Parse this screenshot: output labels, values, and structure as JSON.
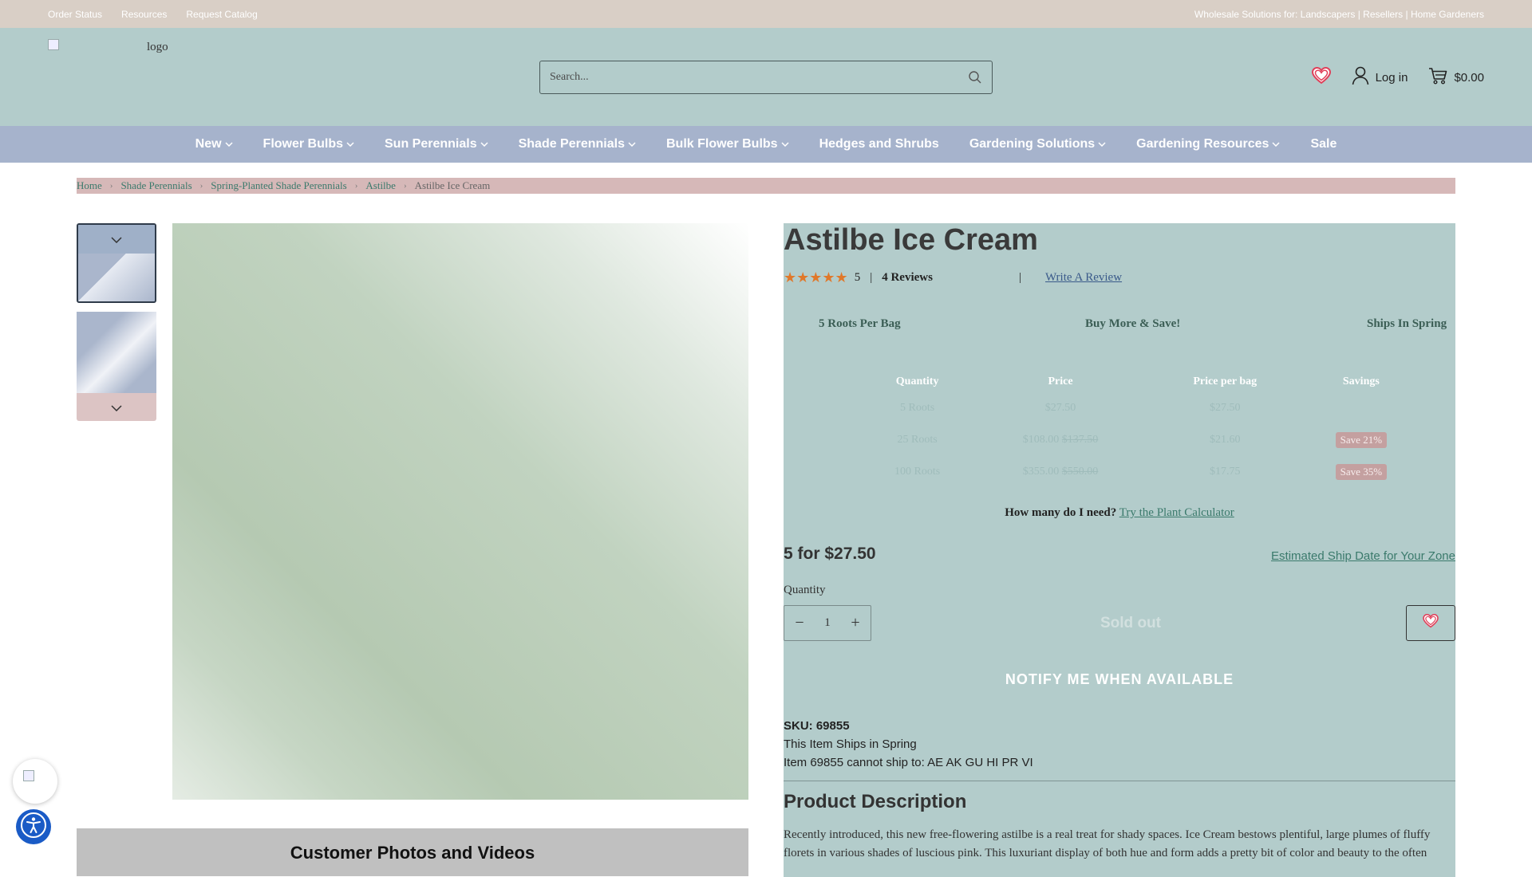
{
  "topbar": {
    "links": [
      "Order Status",
      "Resources",
      "Request Catalog"
    ],
    "wholesale": "Wholesale Solutions for: Landscapers | Resellers | Home Gardeners"
  },
  "header": {
    "logo_alt": "logo",
    "search_placeholder": "Search...",
    "login_label": "Log in",
    "cart_total": "$0.00"
  },
  "nav": {
    "items": [
      {
        "label": "New"
      },
      {
        "label": "Flower Bulbs"
      },
      {
        "label": "Sun Perennials"
      },
      {
        "label": "Shade Perennials"
      },
      {
        "label": "Bulk Flower Bulbs"
      },
      {
        "label": "Hedges and Shrubs"
      },
      {
        "label": "Gardening Solutions"
      },
      {
        "label": "Gardening Resources"
      },
      {
        "label": "Sale"
      }
    ]
  },
  "breadcrumb": {
    "items": [
      "Home",
      "Shade Perennials",
      "Spring-Planted Shade Perennials",
      "Astilbe"
    ],
    "current": "Astilbe Ice Cream"
  },
  "gallery": {
    "photos_title": "Customer Photos and Videos"
  },
  "product": {
    "title": "Astilbe Ice Cream",
    "stars": "★★★★★",
    "rating": "5",
    "reviews": "4 Reviews",
    "write_review": "Write A Review",
    "features": [
      "5 Roots Per Bag",
      "Buy More & Save!",
      "Ships In Spring"
    ],
    "pricing": {
      "headers": [
        "Quantity",
        "Price",
        "Price per bag",
        "Savings"
      ],
      "rows": [
        {
          "qty": "5 Roots",
          "price": "$27.50",
          "was": "",
          "per_bag": "$27.50",
          "savings": ""
        },
        {
          "qty": "25 Roots",
          "price": "$108.00",
          "was": "$137.50",
          "per_bag": "$21.60",
          "savings": "Save 21%"
        },
        {
          "qty": "100 Roots",
          "price": "$355.00",
          "was": "$550.00",
          "per_bag": "$17.75",
          "savings": "Save 35%"
        }
      ]
    },
    "calc_question": "How many do I need?",
    "calc_link": "Try the Plant Calculator",
    "price_line": "5 for $27.50",
    "ship_date_link": "Estimated Ship Date for Your Zone",
    "quantity_label": "Quantity",
    "quantity_value": "1",
    "sold_out_label": "Sold out",
    "notify_label": "NOTIFY ME WHEN AVAILABLE",
    "sku_label": "SKU:",
    "sku_value": "69855",
    "ships_note": "This Item Ships in Spring",
    "cannot_ship": "Item 69855 cannot ship to: AE AK GU HI PR VI",
    "description_title": "Product Description",
    "description": "Recently introduced, this new free-flowering astilbe is a real treat for shady spaces. Ice Cream bestows plentiful, large plumes of fluffy florets in various shades of luscious pink. This luxuriant display of both hue and form adds a pretty bit of color and beauty to the often"
  },
  "colors": {
    "topbar": "#d9cfc6",
    "header": "#b3cccb",
    "nav": "#a6b3cc",
    "star": "#e0782a",
    "link": "#3b7a6c",
    "accessibility": "#1a5bc6"
  }
}
